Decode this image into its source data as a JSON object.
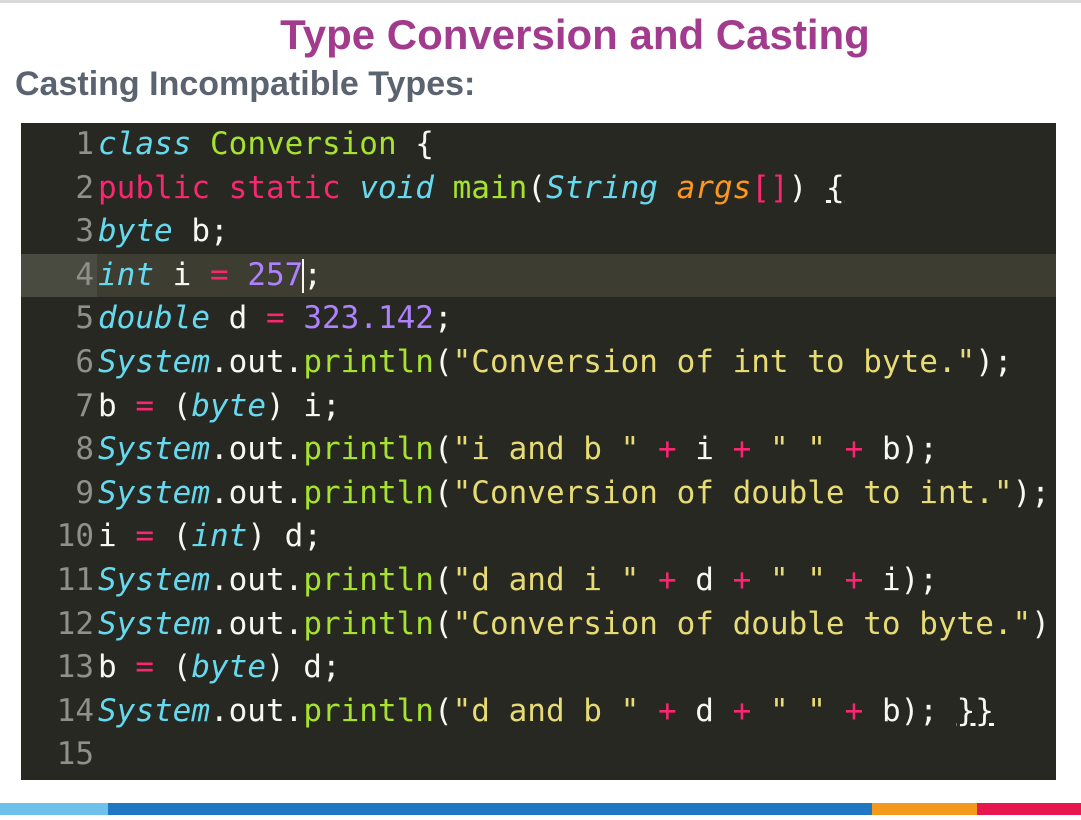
{
  "slide": {
    "title": "Type Conversion and Casting",
    "subtitle": "Casting Incompatible Types:"
  },
  "editor": {
    "active_line": 4,
    "lines": [
      {
        "n": "1",
        "tokens": [
          [
            "kw",
            "class"
          ],
          [
            "plain",
            " "
          ],
          [
            "cls",
            "Conversion"
          ],
          [
            "plain",
            " {"
          ]
        ]
      },
      {
        "n": "2",
        "tokens": [
          [
            "mod",
            "public"
          ],
          [
            "plain",
            " "
          ],
          [
            "mod",
            "static"
          ],
          [
            "plain",
            " "
          ],
          [
            "kw",
            "void"
          ],
          [
            "plain",
            " "
          ],
          [
            "fn",
            "main"
          ],
          [
            "plain",
            "("
          ],
          [
            "kw",
            "String"
          ],
          [
            "plain",
            " "
          ],
          [
            "arg",
            "args"
          ],
          [
            "op",
            "[]"
          ],
          [
            "plain",
            ") "
          ],
          [
            "ul",
            "{"
          ]
        ]
      },
      {
        "n": "3",
        "tokens": [
          [
            "kw",
            "byte"
          ],
          [
            "plain",
            " b;"
          ]
        ]
      },
      {
        "n": "4",
        "tokens": [
          [
            "kw",
            "int"
          ],
          [
            "plain",
            " i "
          ],
          [
            "op",
            "="
          ],
          [
            "plain",
            " "
          ],
          [
            "num",
            "257"
          ],
          [
            "cursor",
            ""
          ],
          [
            "plain",
            ";"
          ]
        ]
      },
      {
        "n": "5",
        "tokens": [
          [
            "kw",
            "double"
          ],
          [
            "plain",
            " d "
          ],
          [
            "op",
            "="
          ],
          [
            "plain",
            " "
          ],
          [
            "num",
            "323.142"
          ],
          [
            "plain",
            ";"
          ]
        ]
      },
      {
        "n": "6",
        "tokens": [
          [
            "obj",
            "System"
          ],
          [
            "plain",
            ".out."
          ],
          [
            "fn",
            "println"
          ],
          [
            "plain",
            "("
          ],
          [
            "str",
            "\"Conversion of int to byte.\""
          ],
          [
            "plain",
            ");"
          ]
        ]
      },
      {
        "n": "7",
        "tokens": [
          [
            "plain",
            "b "
          ],
          [
            "op",
            "="
          ],
          [
            "plain",
            " ("
          ],
          [
            "kw",
            "byte"
          ],
          [
            "plain",
            ") i;"
          ]
        ]
      },
      {
        "n": "8",
        "tokens": [
          [
            "obj",
            "System"
          ],
          [
            "plain",
            ".out."
          ],
          [
            "fn",
            "println"
          ],
          [
            "plain",
            "("
          ],
          [
            "str",
            "\"i and b \""
          ],
          [
            "plain",
            " "
          ],
          [
            "op",
            "+"
          ],
          [
            "plain",
            " i "
          ],
          [
            "op",
            "+"
          ],
          [
            "plain",
            " "
          ],
          [
            "str",
            "\" \""
          ],
          [
            "plain",
            " "
          ],
          [
            "op",
            "+"
          ],
          [
            "plain",
            " b);"
          ]
        ]
      },
      {
        "n": "9",
        "tokens": [
          [
            "obj",
            "System"
          ],
          [
            "plain",
            ".out."
          ],
          [
            "fn",
            "println"
          ],
          [
            "plain",
            "("
          ],
          [
            "str",
            "\"Conversion of double to int.\""
          ],
          [
            "plain",
            ");"
          ]
        ]
      },
      {
        "n": "10",
        "tokens": [
          [
            "plain",
            "i "
          ],
          [
            "op",
            "="
          ],
          [
            "plain",
            " ("
          ],
          [
            "kw",
            "int"
          ],
          [
            "plain",
            ") d;"
          ]
        ]
      },
      {
        "n": "11",
        "tokens": [
          [
            "obj",
            "System"
          ],
          [
            "plain",
            ".out."
          ],
          [
            "fn",
            "println"
          ],
          [
            "plain",
            "("
          ],
          [
            "str",
            "\"d and i \""
          ],
          [
            "plain",
            " "
          ],
          [
            "op",
            "+"
          ],
          [
            "plain",
            " d "
          ],
          [
            "op",
            "+"
          ],
          [
            "plain",
            " "
          ],
          [
            "str",
            "\" \""
          ],
          [
            "plain",
            " "
          ],
          [
            "op",
            "+"
          ],
          [
            "plain",
            " i);"
          ]
        ]
      },
      {
        "n": "12",
        "tokens": [
          [
            "obj",
            "System"
          ],
          [
            "plain",
            ".out."
          ],
          [
            "fn",
            "println"
          ],
          [
            "plain",
            "("
          ],
          [
            "str",
            "\"Conversion of double to byte.\""
          ],
          [
            "plain",
            ");"
          ]
        ]
      },
      {
        "n": "13",
        "tokens": [
          [
            "plain",
            "b "
          ],
          [
            "op",
            "="
          ],
          [
            "plain",
            " ("
          ],
          [
            "kw",
            "byte"
          ],
          [
            "plain",
            ") d;"
          ]
        ]
      },
      {
        "n": "14",
        "tokens": [
          [
            "obj",
            "System"
          ],
          [
            "plain",
            ".out."
          ],
          [
            "fn",
            "println"
          ],
          [
            "plain",
            "("
          ],
          [
            "str",
            "\"d and b \""
          ],
          [
            "plain",
            " "
          ],
          [
            "op",
            "+"
          ],
          [
            "plain",
            " d "
          ],
          [
            "op",
            "+"
          ],
          [
            "plain",
            " "
          ],
          [
            "str",
            "\" \""
          ],
          [
            "plain",
            " "
          ],
          [
            "op",
            "+"
          ],
          [
            "plain",
            " b); "
          ],
          [
            "ul",
            "}}"
          ]
        ]
      },
      {
        "n": "15",
        "tokens": []
      }
    ]
  },
  "colors": {
    "title": "#a23b8e",
    "subtitle": "#5b6370",
    "editor_bg": "#272822",
    "bar_segments": [
      "#6ec1ea",
      "#1f77c4",
      "#f39a1c",
      "#e8164f"
    ]
  }
}
